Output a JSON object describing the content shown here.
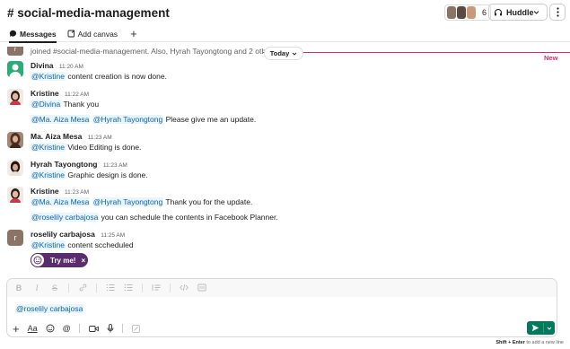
{
  "header": {
    "channel_title": "# social-media-management",
    "member_count": "6",
    "huddle_label": "Huddle"
  },
  "tabs": [
    {
      "label": "Messages"
    },
    {
      "label": "Add canvas"
    }
  ],
  "feed": {
    "join_text": "joined #social-media-management. Also, Hyrah Tayongtong and 2 oth",
    "join_initial": "r",
    "today_label": "Today",
    "new_label": "New",
    "messages": [
      {
        "author": "Divina",
        "time": "11:20 AM",
        "lines": [
          {
            "mentions": [
              "@Kristine"
            ],
            "text": " content creation is now done."
          }
        ]
      },
      {
        "author": "Kristine",
        "time": "11:22 AM",
        "lines": [
          {
            "mentions": [
              "@Divina"
            ],
            "text": " Thank you"
          },
          {
            "mentions": [
              "@Ma. Aiza Mesa",
              "@Hyrah Tayongtong"
            ],
            "text": " Please give me an update."
          }
        ]
      },
      {
        "author": "Ma. Aiza Mesa",
        "time": "11:23 AM",
        "lines": [
          {
            "mentions": [
              "@Kristine"
            ],
            "text": " Video Editing is done."
          }
        ]
      },
      {
        "author": "Hyrah Tayongtong",
        "time": "11:23 AM",
        "lines": [
          {
            "mentions": [
              "@Kristine"
            ],
            "text": " Graphic design is done."
          }
        ]
      },
      {
        "author": "Kristine",
        "time": "11:23 AM",
        "lines": [
          {
            "mentions": [
              "@Ma. Aiza Mesa",
              "@Hyrah Tayongtong"
            ],
            "text": " Thank you for the update."
          },
          {
            "mentions": [
              "@roselily carbajosa"
            ],
            "text": " you can schedule the contents in Facebook Planner."
          }
        ]
      },
      {
        "author": "roselily carbajosa",
        "time": "11:25 AM",
        "avatar_initial": "r",
        "lines": [
          {
            "mentions": [
              "@Kristine"
            ],
            "text": " content sccheduled"
          }
        ]
      }
    ],
    "try_me_label": "Try me!",
    "try_me_close": "×"
  },
  "composer": {
    "value": "@roselily carbajosa",
    "text_style_label": "Aa",
    "hint_keys": "Shift + Enter",
    "hint_text": " to add a new line"
  },
  "colors": {
    "accent_new": "#cf2f6f",
    "mention_text": "#1264a3",
    "mention_bg": "#e8f5fa",
    "try_me_bg": "#5a2b6d",
    "send_bg": "#007a5a",
    "divina_avatar": "#2bac76",
    "roselily_avatar": "#8b7366"
  }
}
